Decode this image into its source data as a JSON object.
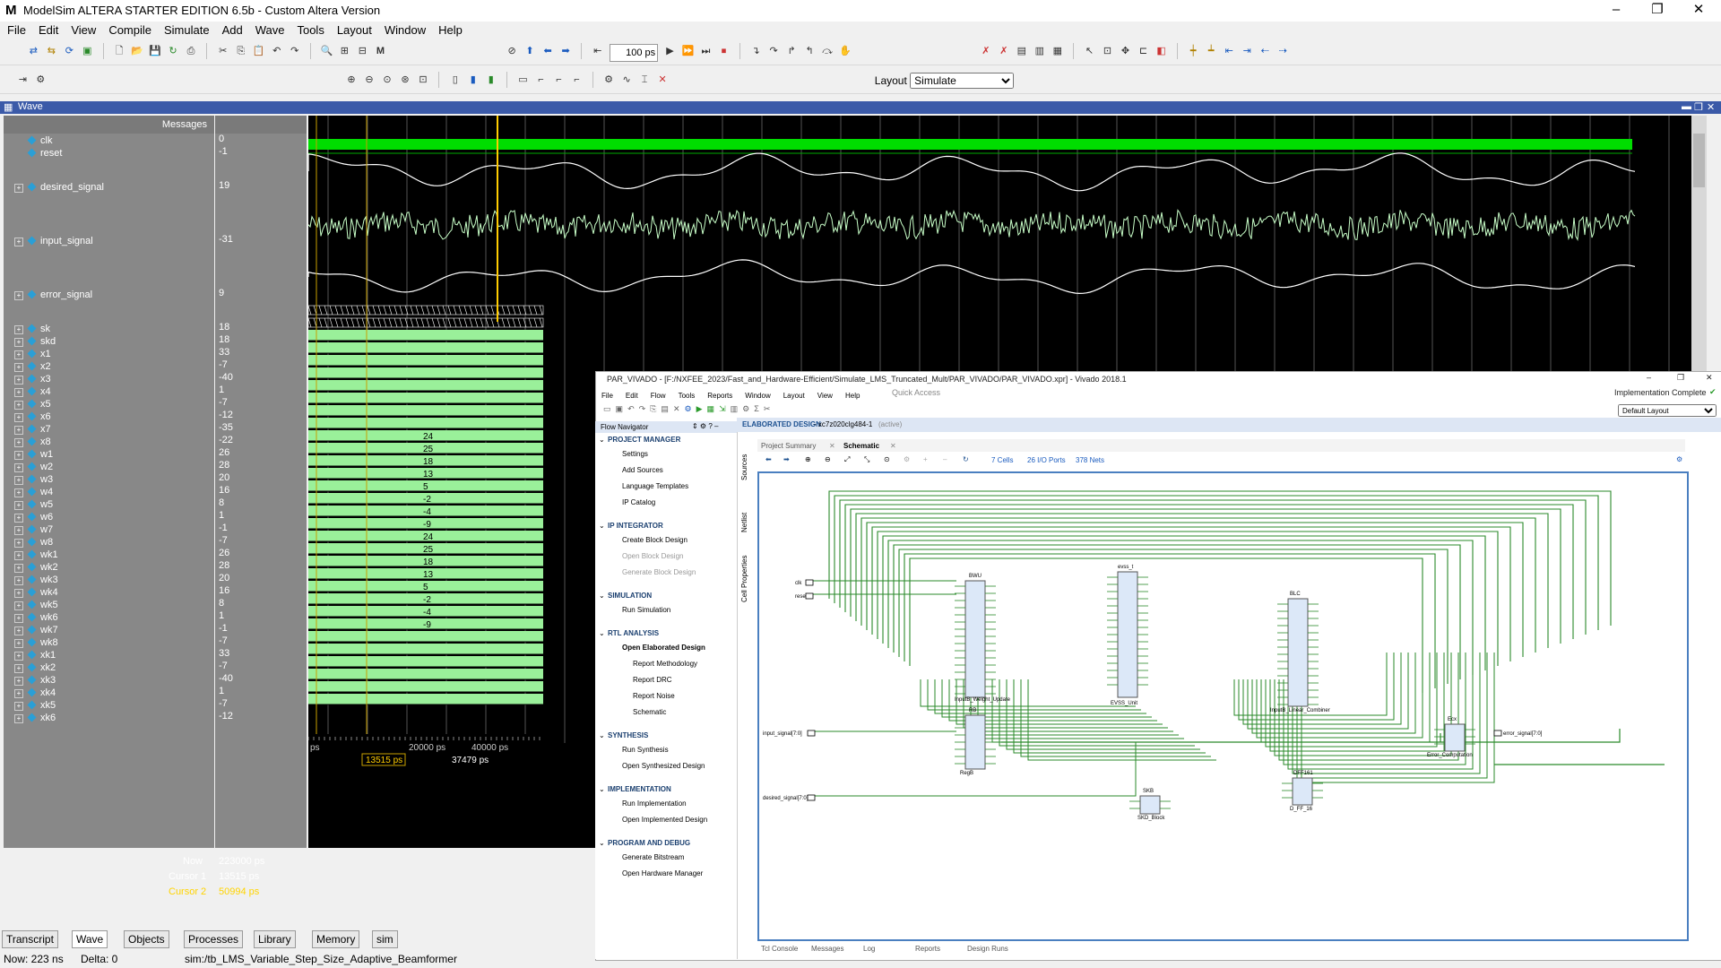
{
  "window": {
    "title": "ModelSim ALTERA STARTER EDITION 6.5b - Custom Altera Version",
    "logo": "M"
  },
  "menu": [
    "File",
    "Edit",
    "View",
    "Compile",
    "Simulate",
    "Add",
    "Wave",
    "Tools",
    "Layout",
    "Window",
    "Help"
  ],
  "toolbar": {
    "run_length": "100 ps",
    "layout_label": "Layout",
    "layout_value": "Simulate"
  },
  "wave": {
    "pane_title": "Wave",
    "messages_header": "Messages",
    "signals": [
      {
        "name": "clk",
        "value": "0",
        "expandable": false
      },
      {
        "name": "reset",
        "value": "-1",
        "expandable": false
      },
      {
        "name": "desired_signal",
        "value": "19",
        "expandable": true
      },
      {
        "name": "input_signal",
        "value": "-31",
        "expandable": true
      },
      {
        "name": "error_signal",
        "value": "9",
        "expandable": true
      },
      {
        "name": "sk",
        "value": "18",
        "expandable": true
      },
      {
        "name": "skd",
        "value": "18",
        "expandable": true
      },
      {
        "name": "x1",
        "value": "33",
        "expandable": true
      },
      {
        "name": "x2",
        "value": "-7",
        "expandable": true
      },
      {
        "name": "x3",
        "value": "-40",
        "expandable": true
      },
      {
        "name": "x4",
        "value": "1",
        "expandable": true
      },
      {
        "name": "x5",
        "value": "-7",
        "expandable": true
      },
      {
        "name": "x6",
        "value": "-12",
        "expandable": true
      },
      {
        "name": "x7",
        "value": "-35",
        "expandable": true
      },
      {
        "name": "x8",
        "value": "-22",
        "expandable": true
      },
      {
        "name": "w1",
        "value": "26",
        "expandable": true
      },
      {
        "name": "w2",
        "value": "28",
        "expandable": true
      },
      {
        "name": "w3",
        "value": "20",
        "expandable": true
      },
      {
        "name": "w4",
        "value": "16",
        "expandable": true
      },
      {
        "name": "w5",
        "value": "8",
        "expandable": true
      },
      {
        "name": "w6",
        "value": "1",
        "expandable": true
      },
      {
        "name": "w7",
        "value": "-1",
        "expandable": true
      },
      {
        "name": "w8",
        "value": "-7",
        "expandable": true
      },
      {
        "name": "wk1",
        "value": "26",
        "expandable": true
      },
      {
        "name": "wk2",
        "value": "28",
        "expandable": true
      },
      {
        "name": "wk3",
        "value": "20",
        "expandable": true
      },
      {
        "name": "wk4",
        "value": "16",
        "expandable": true
      },
      {
        "name": "wk5",
        "value": "8",
        "expandable": true
      },
      {
        "name": "wk6",
        "value": "1",
        "expandable": true
      },
      {
        "name": "wk7",
        "value": "-1",
        "expandable": true
      },
      {
        "name": "wk8",
        "value": "-7",
        "expandable": true
      },
      {
        "name": "xk1",
        "value": "33",
        "expandable": true
      },
      {
        "name": "xk2",
        "value": "-7",
        "expandable": true
      },
      {
        "name": "xk3",
        "value": "-40",
        "expandable": true
      },
      {
        "name": "xk4",
        "value": "1",
        "expandable": true
      },
      {
        "name": "xk5",
        "value": "-7",
        "expandable": true
      },
      {
        "name": "xk6",
        "value": "-12",
        "expandable": true
      }
    ],
    "bus_labels": [
      "24",
      "25",
      "18",
      "13",
      "5",
      "-2",
      "-4",
      "-9",
      "24",
      "25",
      "18",
      "13",
      "5",
      "-2",
      "-4",
      "-9"
    ],
    "now_label": "Now",
    "now_value": "223000 ps",
    "cursor1_label": "Cursor 1",
    "cursor1_value": "13515 ps",
    "cursor2_label": "Cursor 2",
    "cursor2_value": "50994 ps",
    "timeline_ticks": [
      "ps",
      "20000 ps",
      "40000 ps"
    ],
    "cursor1_marker": "13515 ps",
    "cursor_delta": "37479 ps"
  },
  "bottom_tabs": [
    "Transcript",
    "Wave",
    "Objects",
    "Processes",
    "Library",
    "Memory",
    "sim"
  ],
  "status": {
    "now": "Now: 223 ns",
    "delta": "Delta: 0",
    "path": "sim:/tb_LMS_Variable_Step_Size_Adaptive_Beamformer"
  },
  "vivado": {
    "title": "PAR_VIVADO - [F:/NXFEE_2023/Fast_and_Hardware-Efficient/Simulate_LMS_Truncated_Mult/PAR_VIVADO/PAR_VIVADO.xpr] - Vivado 2018.1",
    "menu": [
      "File",
      "Edit",
      "Flow",
      "Tools",
      "Reports",
      "Window",
      "Layout",
      "View",
      "Help"
    ],
    "quick_access": "Quick Access",
    "impl_status": "Implementation Complete",
    "layout": "Default Layout",
    "flow_nav_title": "Flow Navigator",
    "design_title": "ELABORATED DESIGN",
    "design_part": "- xc7z020clg484-1",
    "design_active": "(active)",
    "tabs": [
      "Project Summary",
      "Schematic"
    ],
    "side_tabs": [
      "Sources",
      "Netlist",
      "Cell Properties"
    ],
    "stats": [
      "7 Cells",
      "26 I/O Ports",
      "378 Nets"
    ],
    "flow": [
      {
        "text": "PROJECT MANAGER",
        "type": "h"
      },
      {
        "text": "Settings",
        "type": "i"
      },
      {
        "text": "Add Sources",
        "type": "i"
      },
      {
        "text": "Language Templates",
        "type": "i"
      },
      {
        "text": "IP Catalog",
        "type": "i"
      },
      {
        "text": "IP INTEGRATOR",
        "type": "h"
      },
      {
        "text": "Create Block Design",
        "type": "i"
      },
      {
        "text": "Open Block Design",
        "type": "d"
      },
      {
        "text": "Generate Block Design",
        "type": "d"
      },
      {
        "text": "SIMULATION",
        "type": "h"
      },
      {
        "text": "Run Simulation",
        "type": "i"
      },
      {
        "text": "RTL ANALYSIS",
        "type": "h"
      },
      {
        "text": "Open Elaborated Design",
        "type": "b"
      },
      {
        "text": "Report Methodology",
        "type": "s"
      },
      {
        "text": "Report DRC",
        "type": "s"
      },
      {
        "text": "Report Noise",
        "type": "s"
      },
      {
        "text": "Schematic",
        "type": "s"
      },
      {
        "text": "SYNTHESIS",
        "type": "h"
      },
      {
        "text": "Run Synthesis",
        "type": "i"
      },
      {
        "text": "Open Synthesized Design",
        "type": "i"
      },
      {
        "text": "IMPLEMENTATION",
        "type": "h"
      },
      {
        "text": "Run Implementation",
        "type": "i"
      },
      {
        "text": "Open Implemented Design",
        "type": "i"
      },
      {
        "text": "PROGRAM AND DEBUG",
        "type": "h"
      },
      {
        "text": "Generate Bitstream",
        "type": "i"
      },
      {
        "text": "Open Hardware Manager",
        "type": "i"
      }
    ],
    "blocks": [
      {
        "inst": "BWU",
        "name": "InputB_Weight_Update"
      },
      {
        "inst": "evss_t",
        "name": "EVSS_Unit"
      },
      {
        "inst": "BLC",
        "name": "InputB_Linear_Combiner"
      },
      {
        "inst": "RB",
        "name": "RegB"
      },
      {
        "inst": "Ecx",
        "name": "Error_Computation"
      },
      {
        "inst": "DFF161",
        "name": "D_FF_16"
      },
      {
        "inst": "SKB",
        "name": "SKD_Block"
      }
    ],
    "ports": [
      "clk",
      "reset",
      "input_signal[7:0]",
      "desired_signal[7:0]",
      "error_signal[7:0]"
    ],
    "bottom_tabs": [
      "Tcl Console",
      "Messages",
      "Log",
      "Reports",
      "Design Runs"
    ]
  }
}
